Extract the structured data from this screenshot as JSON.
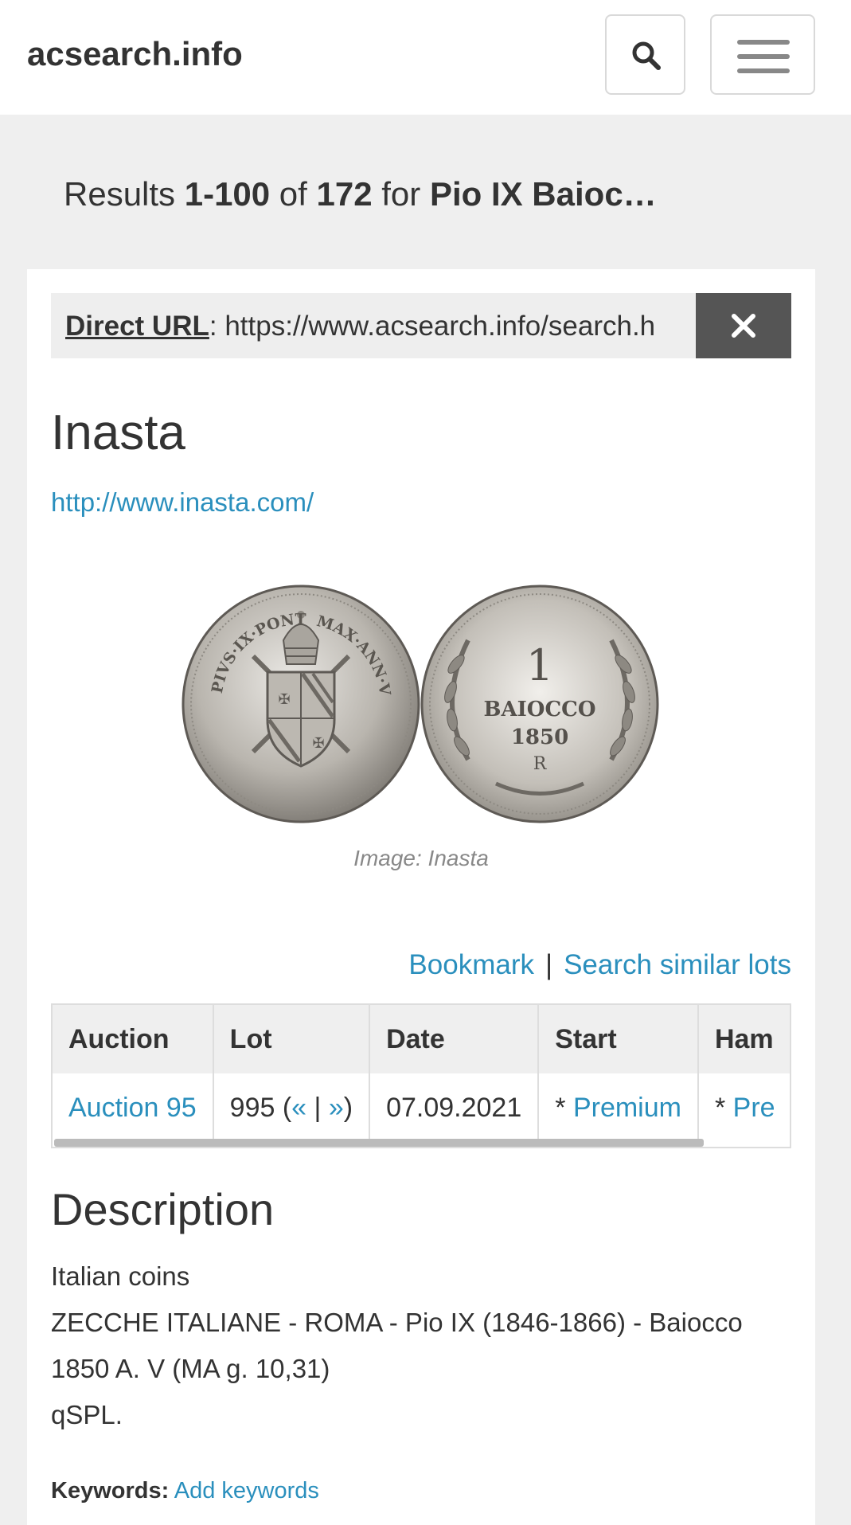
{
  "header": {
    "site_name": "acsearch.info"
  },
  "results": {
    "prefix": "Results ",
    "range": "1-100",
    "of": " of ",
    "total": "172",
    "for": " for ",
    "query": "Pio IX Baioc…"
  },
  "direct_url": {
    "label": "Direct URL",
    "separator": ": ",
    "value": "https://www.acsearch.info/search.h"
  },
  "lot": {
    "auction_house": "Inasta",
    "house_url": "http://www.inasta.com/",
    "image_caption": "Image: Inasta",
    "actions": {
      "bookmark": "Bookmark",
      "separator": "|",
      "search_similar": "Search similar lots"
    },
    "table": {
      "headers": [
        "Auction",
        "Lot",
        "Date",
        "Start",
        "Ham"
      ],
      "row": {
        "auction": "Auction 95",
        "lot_number": "995 (",
        "prev": "«",
        "lot_sep": " | ",
        "next": "»",
        "lot_close": ")",
        "date": "07.09.2021",
        "start_prefix": "* ",
        "start_link": "Premium",
        "hammer_prefix": "* ",
        "hammer_link": "Pre"
      }
    },
    "description": {
      "title": "Description",
      "lines": [
        "Italian coins",
        "ZECCHE ITALIANE - ROMA - Pio IX (1846-1866) - Baiocco",
        "1850 A. V (MA g. 10,31)",
        "qSPL."
      ]
    },
    "keywords": {
      "label": "Keywords:",
      "add": "Add keywords"
    },
    "coin_reverse": {
      "denomination": "1",
      "unit": "BAIOCCO",
      "year": "1850",
      "mint": "R"
    },
    "coin_obverse": {
      "legend_left": "PIVS·IX·PONT",
      "legend_right": "MAX·ANN·V"
    }
  },
  "colors": {
    "link": "#2a8fbd",
    "close_button": "#555555",
    "page_background": "#efefef"
  }
}
